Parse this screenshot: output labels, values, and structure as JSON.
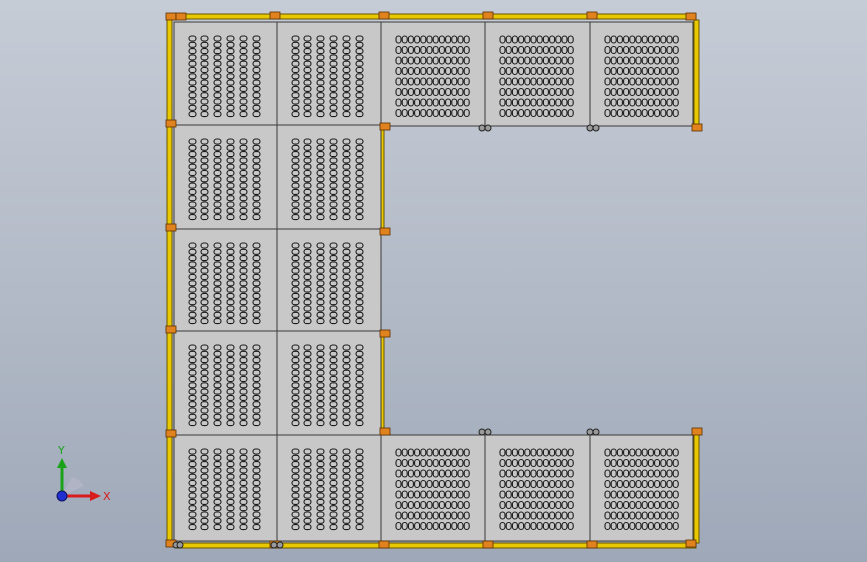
{
  "viewport": {
    "background_top": "#c6ccd6",
    "background_bottom": "#9ea8b8"
  },
  "model": {
    "panel_color": "#c8c8c8",
    "edge_color": "#3a3a3a",
    "rail_color": "#e8c800",
    "bracket_color": "#e0821e"
  },
  "triad": {
    "x_label": "X",
    "y_label": "Y",
    "x_color": "#d81b1b",
    "y_color": "#1aa31a",
    "z_color": "#2030d0"
  }
}
